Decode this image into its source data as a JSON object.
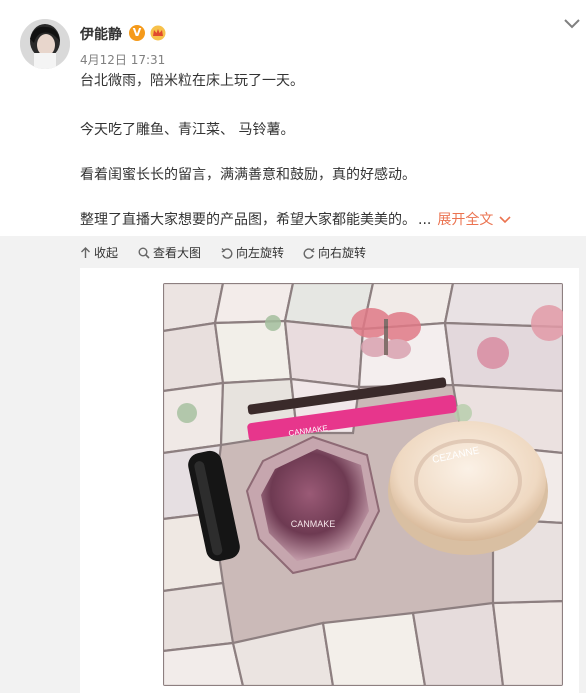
{
  "post": {
    "username": "伊能静",
    "verified_badge": "V",
    "timestamp": "4月12日 17:31",
    "lines": [
      "台北微雨，陪米粒在床上玩了一天。",
      "今天吃了雕鱼、青江菜、 马铃薯。",
      "看着闺蜜长长的留言，满满善意和鼓励，真的好感动。",
      "整理了直播大家想要的产品图，希望大家都能美美的。"
    ],
    "ellipsis": "...",
    "expand_label": "展开全文"
  },
  "toolbar": {
    "collapse_label": "收起",
    "view_large_label": "查看大图",
    "rotate_left_label": "向左旋转",
    "rotate_right_label": "向右旋转"
  },
  "photo": {
    "pencil_text": "CANMAKE",
    "blush_brand": "CANMAKE",
    "powder_brand": "CEZANNE"
  },
  "colors": {
    "link": "#eb7350",
    "text": "#333333",
    "muted": "#808080",
    "panel_bg": "#f2f2f2",
    "verified": "#f59a1a"
  },
  "icons": [
    "chevron-down-icon",
    "collapse-arrow-icon",
    "magnify-icon",
    "rotate-left-icon",
    "rotate-right-icon",
    "crown-badge-icon"
  ]
}
